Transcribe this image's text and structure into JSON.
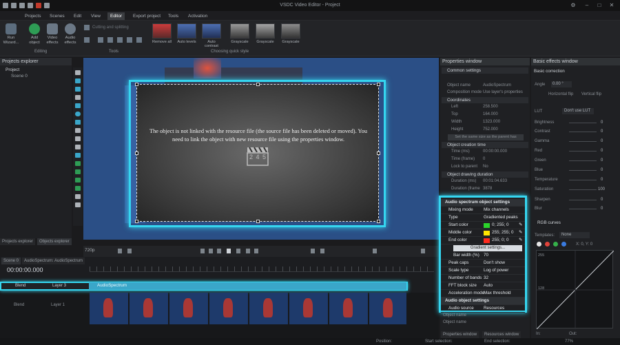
{
  "app": {
    "title": "VSDC Video Editor - Project"
  },
  "menu": [
    "Projects",
    "Scenes",
    "Edit",
    "View",
    "Editor",
    "Export project",
    "Tools",
    "Activation"
  ],
  "ribbon": {
    "buttons": [
      {
        "label": "Run Wizard..."
      },
      {
        "label": "Add object"
      },
      {
        "label": "Video effects"
      },
      {
        "label": "Audio effects"
      }
    ],
    "tools_row": "Cutting and splitting",
    "group_editing": "Editing",
    "group_tools": "Tools",
    "quick_styles": [
      "Remove all",
      "Auto levels",
      "Auto contrast",
      "Grayscale",
      "Grayscale",
      "Grayscale"
    ],
    "group_quick": "Choosing quick style"
  },
  "projects": {
    "title": "Projects explorer",
    "root": "Project",
    "scene": "Scene 0"
  },
  "canvas": {
    "message": "The object is not linked with the resource file (the source file has been deleted or moved). You need to link the object with new resource file using the properties window.",
    "clapper": "2 4 5"
  },
  "tabs_bottom_left": [
    "Projects explorer",
    "Objects explorer"
  ],
  "playback": {
    "zoom": "720p"
  },
  "timeline": {
    "tabs": [
      "Scene 0",
      "AudioSpectrum: AudioSpectrum"
    ],
    "timecode": "00:00:00.000",
    "track1": {
      "blend": "Blend",
      "layer": "Layer 3",
      "clip": "AudioSpectrum"
    },
    "track2": {
      "blend": "Blend",
      "layer": "Layer 1"
    }
  },
  "status": {
    "position": "Position:",
    "start_selection": "Start selection:",
    "end_selection": "End selection:",
    "zoom": "77%"
  },
  "properties": {
    "title": "Properties window",
    "common": "Common settings",
    "rows": [
      {
        "k": "Object name",
        "v": "AudioSpectrum"
      },
      {
        "k": "Composition mode",
        "v": "Use layer's properties"
      }
    ],
    "coords": "Coordinates",
    "coord_rows": [
      {
        "k": "Left",
        "v": "258.500"
      },
      {
        "k": "Top",
        "v": "164.000"
      },
      {
        "k": "Width",
        "v": "1323.000"
      },
      {
        "k": "Height",
        "v": "752.000"
      }
    ],
    "set_same": "Set the same size as the parent has",
    "creation": "Object creation time",
    "creation_rows": [
      {
        "k": "Time (ms)",
        "v": "00:00:00.000"
      },
      {
        "k": "Time (frame)",
        "v": "0"
      },
      {
        "k": "Lock to parent",
        "v": "No"
      }
    ],
    "duration": "Object drawing duration",
    "duration_rows": [
      {
        "k": "Duration (ms)",
        "v": "00:01:04.633"
      },
      {
        "k": "Duration (frame",
        "v": "3878"
      }
    ],
    "tail": [
      "Audio source",
      "Object name",
      "Object name"
    ],
    "tabs": [
      "Properties window",
      "Resources window"
    ]
  },
  "audio_settings": {
    "header": "Audio spectrum object settings",
    "rows": [
      {
        "k": "Mixing mode",
        "v": "Mix channels"
      },
      {
        "k": "Type",
        "v": "Gradiented peaks"
      },
      {
        "k": "Start color",
        "v": "0; 255; 0",
        "color": "#2bd42b"
      },
      {
        "k": "Middle color",
        "v": "255; 255; 0",
        "color": "#ffe600"
      },
      {
        "k": "End color",
        "v": "255; 0; 0",
        "color": "#ff2a1e"
      }
    ],
    "gradient_btn": "Gradient settings...",
    "rows2": [
      {
        "k": "Bar width (%)",
        "v": "70"
      },
      {
        "k": "Peak caps",
        "v": "Don't show"
      },
      {
        "k": "Scale type",
        "v": "Log of power"
      },
      {
        "k": "Number of bands",
        "v": "32"
      },
      {
        "k": "FFT block size",
        "v": "Auto"
      },
      {
        "k": "Acceleration mode",
        "v": "Max threshold"
      }
    ],
    "header2": "Audio object settings",
    "audio_source": {
      "k": "Audio source",
      "v": "Resources"
    }
  },
  "effects": {
    "title": "Basic effects window",
    "basic": "Basic correction",
    "angle": {
      "k": "Angle",
      "v": "0.00 °"
    },
    "flip": [
      "Horizontal flip",
      "Vertical flip"
    ],
    "lut": {
      "k": "LUT",
      "v": "Don't use LUT"
    },
    "sliders": [
      {
        "k": "Brightness",
        "v": "0"
      },
      {
        "k": "Contrast",
        "v": "0"
      },
      {
        "k": "Gamma",
        "v": "0"
      },
      {
        "k": "Red",
        "v": "0"
      },
      {
        "k": "Green",
        "v": "0"
      },
      {
        "k": "Blue",
        "v": "0"
      },
      {
        "k": "Temperature",
        "v": "0"
      },
      {
        "k": "Saturation",
        "v": "100"
      },
      {
        "k": "Sharpen",
        "v": "0"
      },
      {
        "k": "Blur",
        "v": "0"
      }
    ],
    "rgb": "RGB curves",
    "templates": {
      "k": "Templates:",
      "v": "None"
    },
    "xy": "X: 0, Y: 0",
    "axis": [
      "255",
      "128"
    ],
    "in_out": [
      "In:",
      "Out:"
    ]
  },
  "colors": {
    "accent": "#35d6f0",
    "audioclip": "#3aa6c9",
    "preview_bg": "#2b4f86"
  }
}
